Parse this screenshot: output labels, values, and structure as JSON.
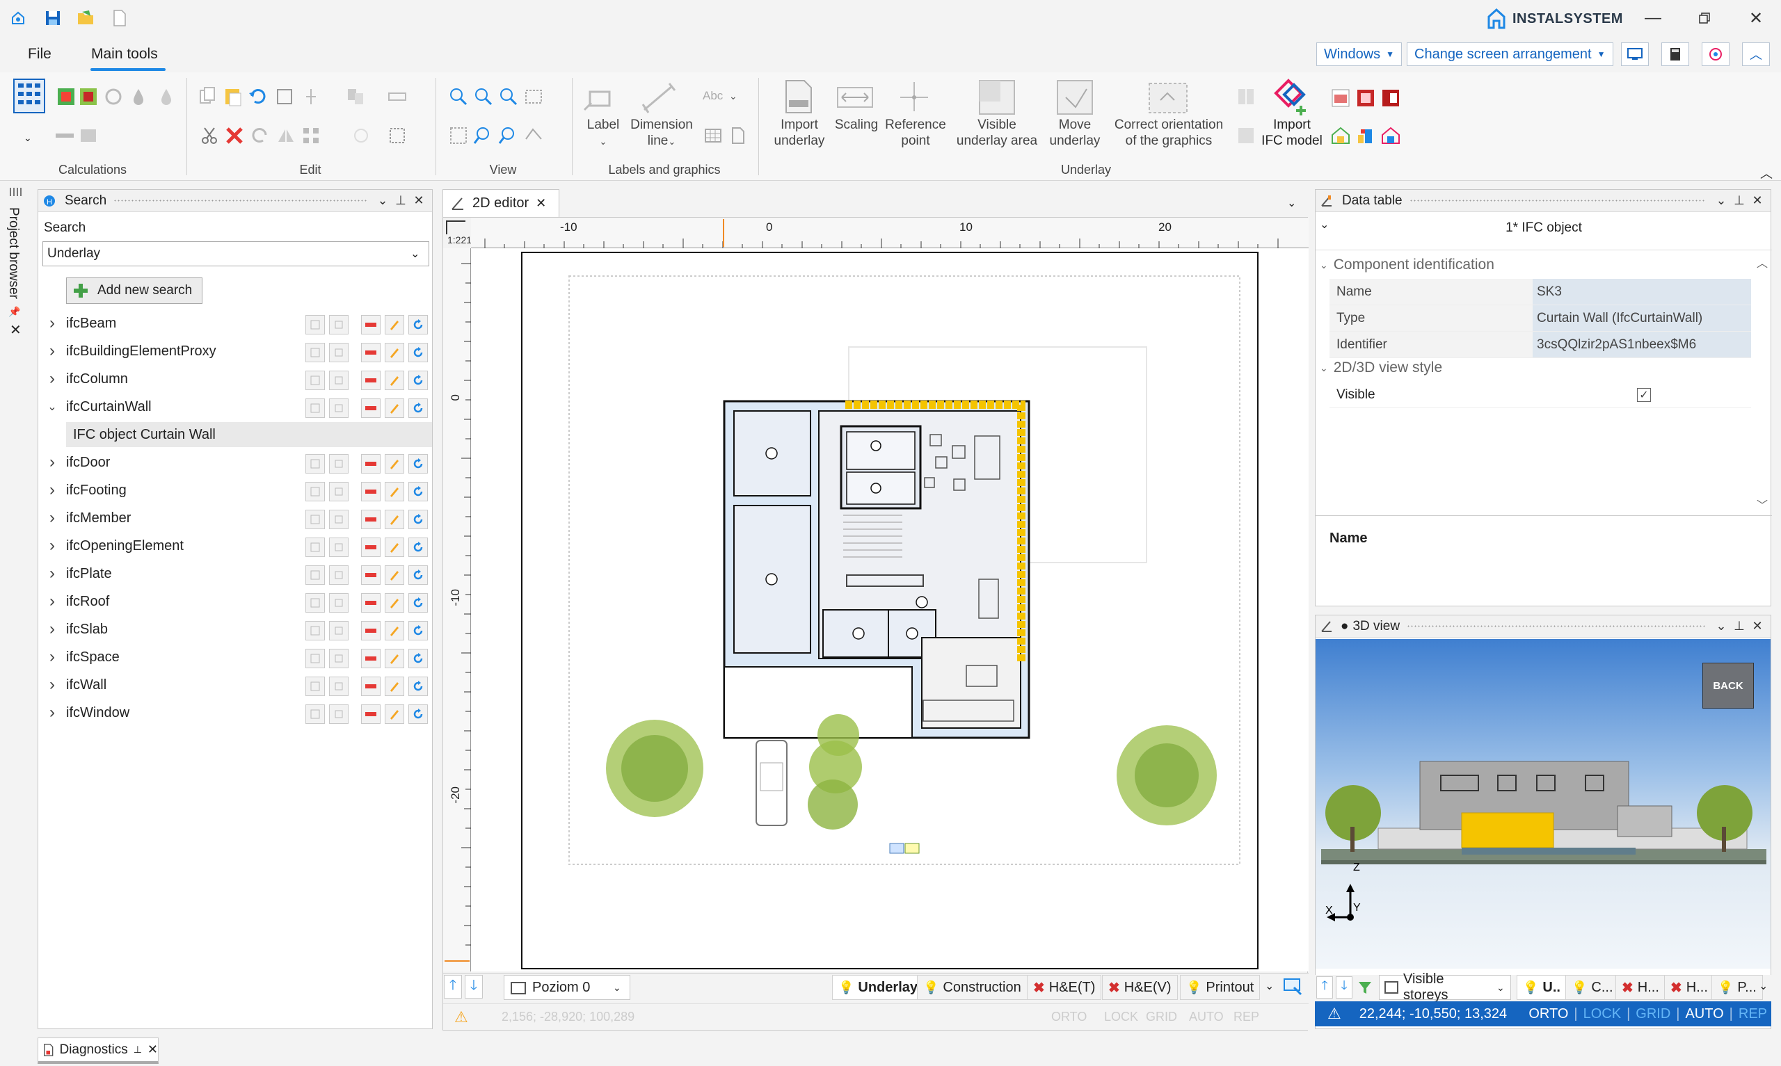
{
  "app": {
    "brand": "INSTALSYSTEM"
  },
  "menu": {
    "file": "File",
    "main_tools": "Main tools"
  },
  "toolbar": {
    "windows": "Windows",
    "change_screen": "Change screen arrangement"
  },
  "ribbon": {
    "groups": {
      "calculations": "Calculations",
      "edit": "Edit",
      "view": "View",
      "labels": "Labels and graphics",
      "underlay": "Underlay"
    },
    "buttons": {
      "label": "Label",
      "dimension_line1": "Dimension",
      "dimension_line2": "line",
      "import_underlay1": "Import",
      "import_underlay2": "underlay",
      "scaling": "Scaling",
      "reference_point1": "Reference",
      "reference_point2": "point",
      "visible_area1": "Visible",
      "visible_area2": "underlay area",
      "move_underlay1": "Move",
      "move_underlay2": "underlay",
      "correct_orientation1": "Correct orientation",
      "correct_orientation2": "of the graphics",
      "import_ifc1": "Import",
      "import_ifc2": "IFC model",
      "abc": "Abc"
    }
  },
  "project_browser": {
    "label": "Project browser"
  },
  "search_panel": {
    "title": "Search",
    "search_label": "Search",
    "dropdown_value": "Underlay",
    "add_new": "Add new search",
    "items": [
      {
        "label": "ifcBeam",
        "expanded": false
      },
      {
        "label": "ifcBuildingElementProxy",
        "expanded": false
      },
      {
        "label": "ifcColumn",
        "expanded": false
      },
      {
        "label": "ifcCurtainWall",
        "expanded": true
      },
      {
        "label": "IFC object Curtain Wall",
        "child": true
      },
      {
        "label": "ifcDoor",
        "expanded": false
      },
      {
        "label": "ifcFooting",
        "expanded": false
      },
      {
        "label": "ifcMember",
        "expanded": false
      },
      {
        "label": "ifcOpeningElement",
        "expanded": false
      },
      {
        "label": "ifcPlate",
        "expanded": false
      },
      {
        "label": "ifcRoof",
        "expanded": false
      },
      {
        "label": "ifcSlab",
        "expanded": false
      },
      {
        "label": "ifcSpace",
        "expanded": false
      },
      {
        "label": "ifcWall",
        "expanded": false
      },
      {
        "label": "ifcWindow",
        "expanded": false
      }
    ]
  },
  "editor": {
    "tab": "2D editor",
    "ruler_corner": "1:221",
    "ruler_top": [
      "-10",
      "0",
      "10",
      "20"
    ],
    "ruler_left": [
      "0",
      "-10",
      "-20"
    ],
    "level": "Poziom 0",
    "status_tabs": {
      "underlay": "Underlay",
      "construction": "Construction",
      "het": "H&E(T)",
      "hev": "H&E(V)",
      "printout": "Printout"
    },
    "coords": "2,156; -28,920; 100,289",
    "flags": [
      "ORTO",
      "LOCK",
      "GRID",
      "AUTO",
      "REP"
    ]
  },
  "data_table": {
    "title": "Data table",
    "selection": "1* IFC object",
    "sections": {
      "component": "Component identification",
      "view_style": "2D/3D view style"
    },
    "rows": [
      {
        "key": "Name",
        "value": "SK3"
      },
      {
        "key": "Type",
        "value": "Curtain Wall (IfcCurtainWall)"
      },
      {
        "key": "Identifier",
        "value": "3csQQlzir2pAS1nbeex$M6"
      }
    ],
    "visible_label": "Visible",
    "visible_checked": true,
    "footer_label": "Name"
  },
  "view3d": {
    "title": "3D view",
    "back": "BACK",
    "axes": {
      "z": "Z",
      "x": "X",
      "y": "Y"
    },
    "visible_storeys": "Visible storeys",
    "short_tabs": [
      "U..",
      "C...",
      "H...",
      "H...",
      "P..."
    ],
    "coords": "22,244; -10,550; 13,324",
    "flags": [
      "ORTO",
      "LOCK",
      "GRID",
      "AUTO",
      "REP"
    ]
  },
  "diagnostics": {
    "title": "Diagnostics"
  },
  "colors": {
    "accent": "#1e88e5",
    "status_blue": "#1565c0",
    "curtain_wall": "#f5c400",
    "room_fill": "#dbe8f6"
  }
}
